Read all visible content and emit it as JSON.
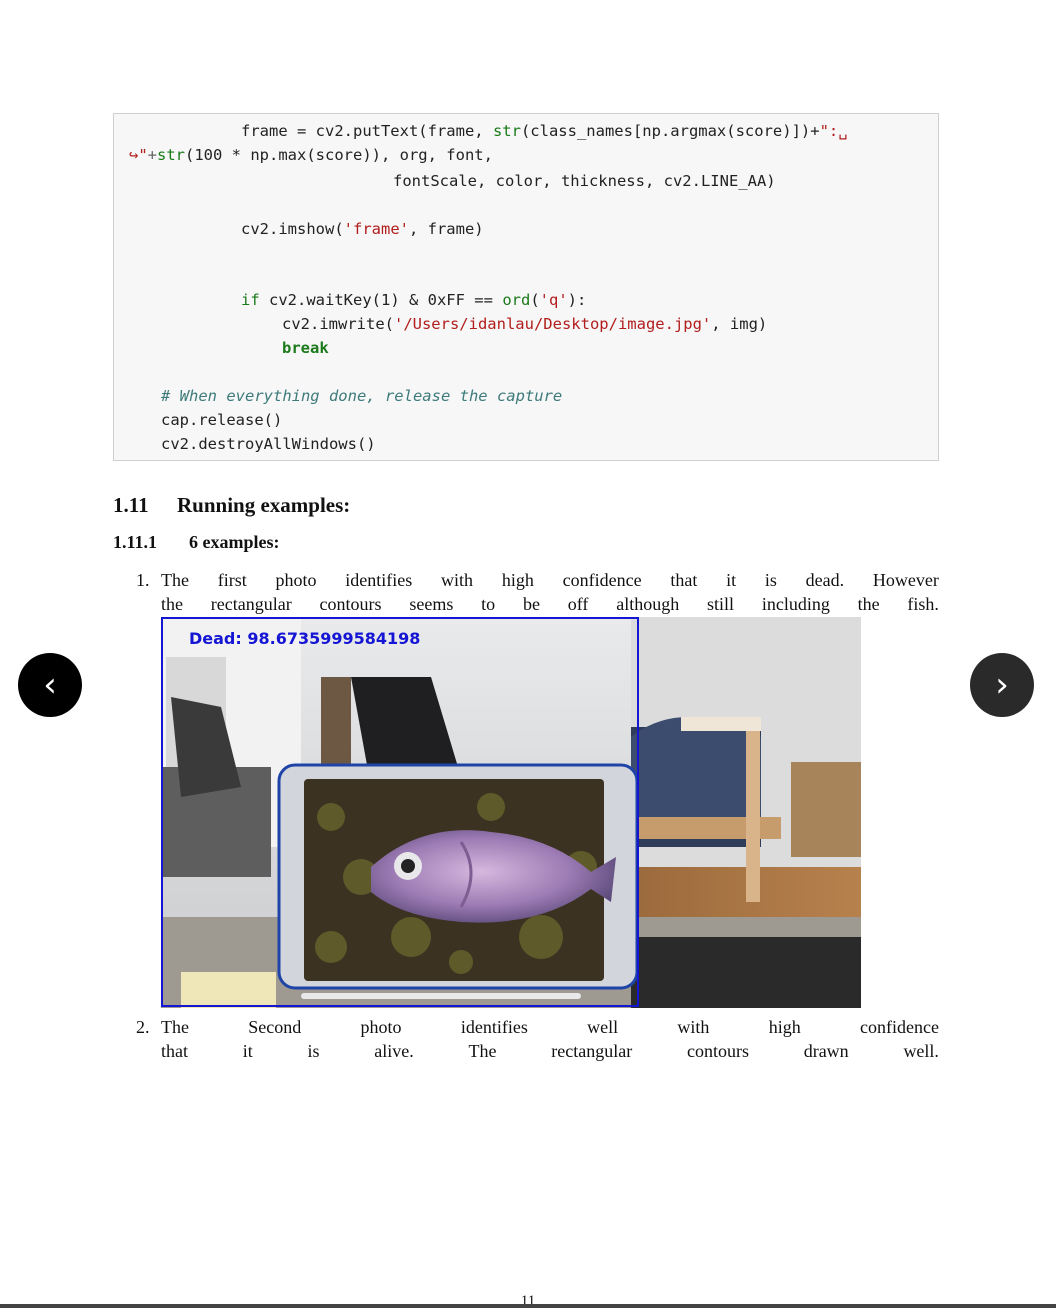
{
  "code": {
    "l1a": "frame = cv2.putText(frame, ",
    "l1b": "str",
    "l1c": "(class_names[np.argmax(score)])+",
    "l1d": "\":␣",
    "l2a": "↪\"",
    "l2b": "+",
    "l2c": "str",
    "l2d": "(100 * np.max(score)), org, font,",
    "l3": "fontScale, color, thickness, cv2.LINE_AA)",
    "l4a": "cv2.imshow(",
    "l4b": "'frame'",
    "l4c": ", frame)",
    "l5a": "if",
    "l5b": " cv2.waitKey(1) & 0xFF == ",
    "l5c": "ord",
    "l5d": "(",
    "l5e": "'q'",
    "l5f": "):",
    "l6a": "cv2.imwrite(",
    "l6b": "'/Users/idanlau/Desktop/image.jpg'",
    "l6c": ", img)",
    "l7": "break",
    "l8": "# When everything done, release the capture",
    "l9": "cap.release()",
    "l10": "cv2.destroyAllWindows()"
  },
  "section": {
    "num": "1.11",
    "title": "Running examples:",
    "sub_num": "1.11.1",
    "sub_title": "6 examples:"
  },
  "items": [
    {
      "num": "1.",
      "line1": [
        "The",
        "first",
        "photo",
        "identifies",
        "with",
        "high",
        "confidence",
        "that",
        "it",
        "is",
        "dead.",
        "However"
      ],
      "line2": [
        "the",
        "rectangular",
        "contours",
        "seems",
        "to",
        "be",
        "off",
        "although",
        "still",
        "including",
        "the",
        "fish."
      ]
    },
    {
      "num": "2.",
      "line1": [
        "The",
        "Second",
        "photo",
        "identifies",
        "well",
        "with",
        "high",
        "confidence"
      ],
      "line2": [
        "that",
        "it",
        "is",
        "alive.",
        "The",
        "rectangular",
        "contours",
        "drawn",
        "well."
      ]
    }
  ],
  "photo": {
    "overlay_label": "Dead: 98.67359995841",
    "overlay_label_tail": "98"
  },
  "nav": {
    "prev_glyph": "‹",
    "next_glyph": "›"
  },
  "page_number": "11"
}
